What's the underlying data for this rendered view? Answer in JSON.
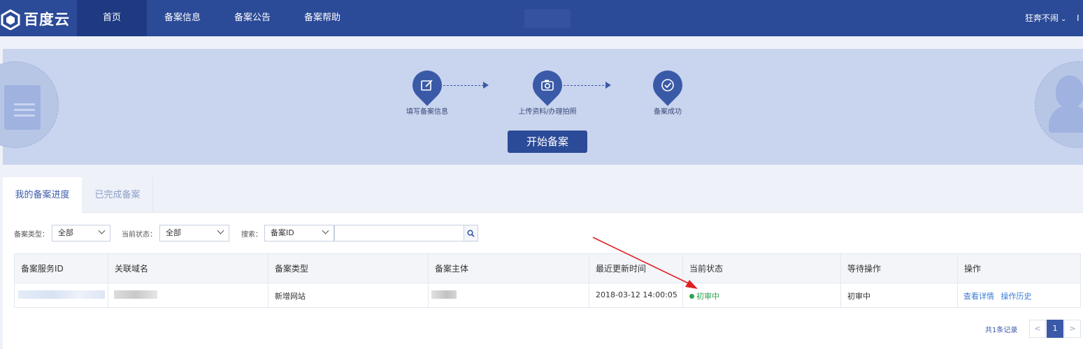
{
  "nav": {
    "logo_text": "百度云",
    "items": [
      "首页",
      "备案信息",
      "备案公告",
      "备案帮助"
    ],
    "user_name": "狂奔不闹",
    "user_extra": "I"
  },
  "banner": {
    "steps": [
      "填写备案信息",
      "上传资料/办理拍照",
      "备案成功"
    ],
    "start_button": "开始备案"
  },
  "tabs": [
    "我的备案进度",
    "已完成备案"
  ],
  "filters": {
    "type_label": "备案类型：",
    "type_value": "全部",
    "status_label": "当前状态：",
    "status_value": "全部",
    "search_label": "搜索：",
    "search_field": "备案ID",
    "search_value": ""
  },
  "table": {
    "headers": [
      "备案服务ID",
      "关联域名",
      "备案类型",
      "备案主体",
      "最近更新时间",
      "当前状态",
      "等待操作",
      "操作"
    ],
    "row": {
      "type": "新增网站",
      "updated": "2018-03-12 14:00:05",
      "status": "初审中",
      "waiting": "初审中",
      "action_detail": "查看详情",
      "action_history": "操作历史"
    }
  },
  "pagination": {
    "total": "共1条记录",
    "prev": "<",
    "current": "1",
    "next": ">"
  },
  "colors": {
    "nav_bg": "#2b4a97",
    "accent": "#3a5aa8",
    "status_green": "#2ea44f",
    "link_blue": "#3a7bd5",
    "annotation_red": "#e02020"
  }
}
